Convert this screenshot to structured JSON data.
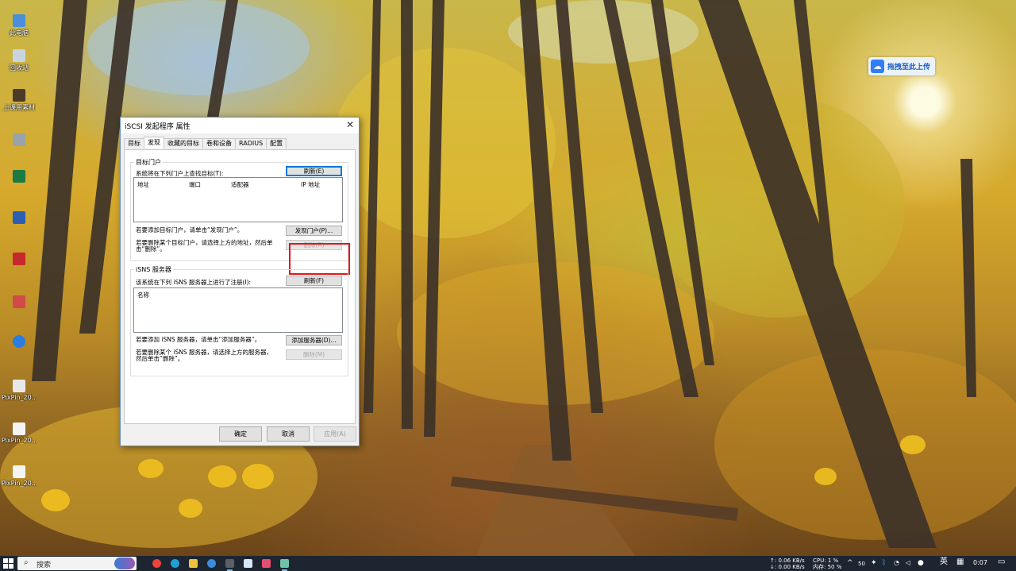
{
  "desktop": {
    "icons": [
      {
        "label": "此电脑"
      },
      {
        "label": "回收站"
      },
      {
        "label": "上课用素材"
      },
      {
        "label": ""
      },
      {
        "label": ""
      },
      {
        "label": ""
      },
      {
        "label": ""
      },
      {
        "label": ""
      },
      {
        "label": ""
      },
      {
        "label": "PixPin_20..."
      },
      {
        "label": "PixPin_20..."
      },
      {
        "label": "PixPin_20..."
      }
    ],
    "upload_widget": {
      "label": "拖拽至此上传",
      "icon": "cloud-upload-icon"
    }
  },
  "dialog": {
    "title": "iSCSI 发起程序 属性",
    "close": "✕",
    "tabs": [
      "目标",
      "发现",
      "收藏的目标",
      "卷和设备",
      "RADIUS",
      "配置"
    ],
    "active_tab": "发现",
    "portals": {
      "legend": "目标门户",
      "desc": "系统将在下列门户上查找目标(T):",
      "refresh": "刷新(E)",
      "columns": [
        "地址",
        "端口",
        "适配器",
        "IP 地址"
      ],
      "add_hint": "若要添加目标门户，请单击“发现门户”。",
      "discover": "发现门户(P)...",
      "remove_hint_1": "若要删除某个目标门户，请选择上方的地址，然后单",
      "remove_hint_2": "击“删除”。",
      "remove": "删除(R)"
    },
    "isns": {
      "legend": "iSNS 服务器",
      "desc": "该系统在下列 iSNS 服务器上进行了注册(I):",
      "refresh": "刷新(F)",
      "columns": [
        "名称"
      ],
      "add_hint": "若要添加 iSNS 服务器，请单击“添加服务器”。",
      "add": "添加服务器(D)...",
      "remove_hint_1": "若要删除某个 iSNS 服务器，请选择上方的服务器，",
      "remove_hint_2": "然后单击“删除”。",
      "remove": "删除(M)"
    },
    "footer": {
      "ok": "确定",
      "cancel": "取消",
      "apply": "应用(A)"
    }
  },
  "taskbar": {
    "search_placeholder": "搜索",
    "net_up": "↑: 0.06 KB/s",
    "net_down": "↓: 0.00 KB/s",
    "cpu": "CPU: 1 %",
    "mem": "内存: 50 %",
    "temp": "50",
    "ime": "英",
    "time": "0:07",
    "apps": [
      "copilot",
      "chrome",
      "edge",
      "file-explorer",
      "app",
      "terminal",
      "app",
      "app",
      "app"
    ]
  }
}
